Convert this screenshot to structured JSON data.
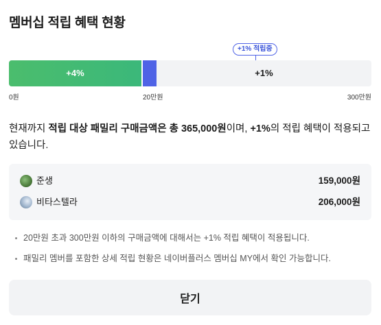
{
  "title": "멤버십 적립 혜택 현황",
  "progress": {
    "current_amount": 365000,
    "max_amount": 3000000,
    "green_segment_label": "+4%",
    "rest_segment_label": "+1%",
    "badge": "+1% 적립중",
    "ticks": [
      "0원",
      "20만원",
      "300만원"
    ],
    "colors": {
      "green": "#4bbd6d",
      "blue": "#4f63e6",
      "track": "#f2f3f5"
    }
  },
  "summary": {
    "prefix": "현재까지 ",
    "strong1": "적립 대상 패밀리 구매금액은 총 365,000원",
    "middle": "이며, ",
    "strong2": "+1%",
    "suffix": "의 적립 혜택이 적용되고 있습니다."
  },
  "members": [
    {
      "name": "준생",
      "amount": "159,000원",
      "avatar": "profile-photo"
    },
    {
      "name": "비타스텔라",
      "amount": "206,000원",
      "avatar": "profile-photo"
    }
  ],
  "notes": [
    "20만원 초과 300만원 이하의 구매금액에 대해서는 +1% 적립 혜택이 적용됩니다.",
    "패밀리 멤버를 포함한 상세 적립 현황은 네이버플러스 멤버십 MY에서 확인 가능합니다."
  ],
  "close_label": "닫기"
}
